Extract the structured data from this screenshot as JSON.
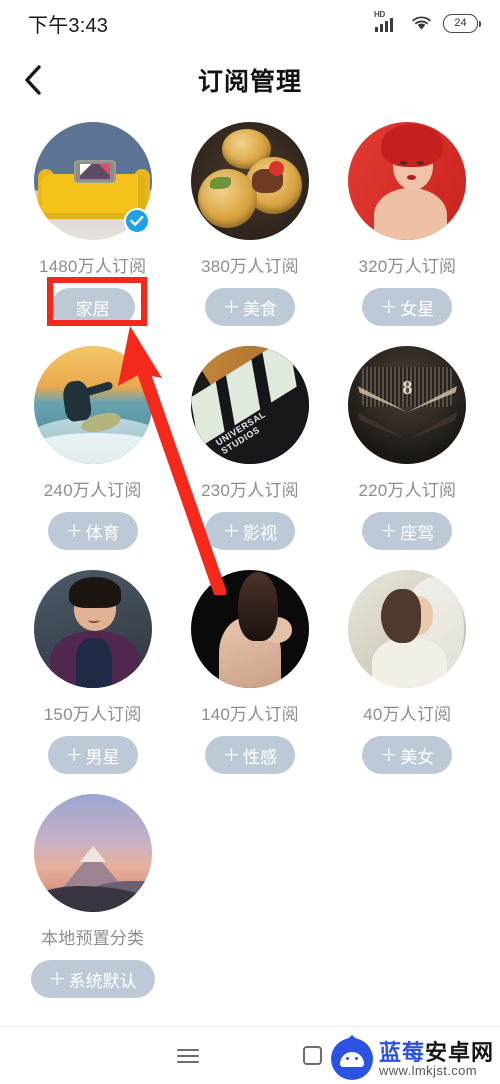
{
  "status_bar": {
    "time": "下午3:43",
    "network_badge": "HD",
    "signal_icon": "signal-bars-icon",
    "wifi_icon": "wifi-icon",
    "battery_level": "24"
  },
  "header": {
    "back_icon": "chevron-left-icon",
    "title": "订阅管理"
  },
  "categories": [
    {
      "id": "home",
      "image": "yellow-sofa-photo",
      "subscribers": "1480万人订阅",
      "button_label": "家居",
      "subscribed": true,
      "show_plus": false,
      "highlighted": true
    },
    {
      "id": "food",
      "image": "food-tarts-photo",
      "subscribers": "380万人订阅",
      "button_label": "美食",
      "subscribed": false,
      "show_plus": true,
      "highlighted": false
    },
    {
      "id": "actress",
      "image": "red-portrait-photo",
      "subscribers": "320万人订阅",
      "button_label": "女星",
      "subscribed": false,
      "show_plus": true,
      "highlighted": false
    },
    {
      "id": "sports",
      "image": "surfer-sunset-photo",
      "subscribers": "240万人订阅",
      "button_label": "体育",
      "subscribed": false,
      "show_plus": true,
      "highlighted": false
    },
    {
      "id": "movies",
      "image": "clapperboard-photo",
      "subscribers": "230万人订阅",
      "button_label": "影视",
      "subscribed": false,
      "show_plus": true,
      "highlighted": false
    },
    {
      "id": "cars",
      "image": "v8-car-emblem-photo",
      "subscribers": "220万人订阅",
      "button_label": "座驾",
      "subscribed": false,
      "show_plus": true,
      "highlighted": false
    },
    {
      "id": "actor",
      "image": "male-celebrity-photo",
      "subscribers": "150万人订阅",
      "button_label": "男星",
      "subscribed": false,
      "show_plus": true,
      "highlighted": false
    },
    {
      "id": "sexy",
      "image": "bare-back-photo",
      "subscribers": "140万人订阅",
      "button_label": "性感",
      "subscribed": false,
      "show_plus": true,
      "highlighted": false
    },
    {
      "id": "beauty",
      "image": "young-woman-photo",
      "subscribers": "40万人订阅",
      "button_label": "美女",
      "subscribed": false,
      "show_plus": true,
      "highlighted": false
    },
    {
      "id": "system-default",
      "image": "mountain-sunset-photo",
      "subscribers": "本地预置分类",
      "button_label": "系统默认",
      "subscribed": false,
      "show_plus": true,
      "highlighted": false
    }
  ],
  "annotation": {
    "highlight_color": "#f4291b",
    "arrow_color": "#f4291b",
    "target": "家居"
  },
  "nav_bar": {
    "menu_icon": "hamburger-menu-icon",
    "recents_icon": "square-recents-icon"
  },
  "watermark": {
    "brand_blue": "蓝莓",
    "brand_black": "安卓网",
    "url": "www.lmkjst.com",
    "logo_icon": "android-crown-logo-icon",
    "brand_color": "#2b52e0"
  },
  "theme": {
    "pill_bg": "#bdc9d6",
    "pill_text": "#ffffff",
    "check_badge": "#1ea2e5",
    "subtext": "#8d8d8d"
  }
}
